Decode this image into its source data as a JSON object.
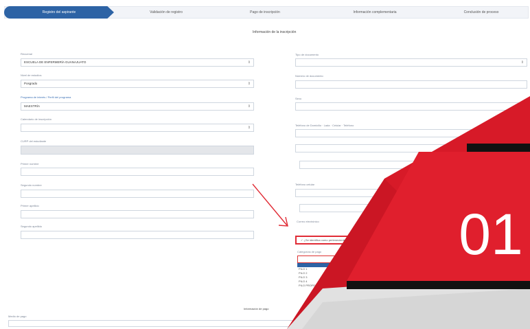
{
  "steps": [
    {
      "label": "Registro del aspirante",
      "active": true
    },
    {
      "label": "Validación de registro",
      "active": false
    },
    {
      "label": "Pago de inscripción",
      "active": false
    },
    {
      "label": "Información complementaria",
      "active": false
    },
    {
      "label": "Conclusión de proceso",
      "active": false
    }
  ],
  "section_title": "Información de la inscripción",
  "left_form": {
    "campus_label": "Recuenal",
    "campus_value": "ESCUELA DE ENFERMERÍA GUANAJUATO",
    "level_label": "Nivel de estudios",
    "level_value": "Posgrado",
    "program_label": "Programa de interés / Perfil del programa",
    "program_value": "MAESTRÍA",
    "calendar_label": "Calendario de inscripción",
    "name_label": "Primer nombre",
    "second_name_label": "Segundo nombre",
    "last1_label": "Primer apellido",
    "last2_label": "Segundo apellido",
    "curp_label": "CURP del estudiante"
  },
  "right_form": {
    "doc_type_label": "Tipo de documento",
    "doc_number_label": "Número de documento",
    "sex_label": "Sexo",
    "phone_label": "Teléfono de Domicilio · Lada · Celular · Teléfono",
    "mobile_label": "Teléfono celular",
    "email_label": "Correo electrónico"
  },
  "checkbox_label": "¿Se identifica como perteneciente a un grupo indígena?",
  "dropdown": {
    "label": "Categorías de pago",
    "options": [
      "",
      "PILO 1",
      "PILO 2",
      "PILO 3",
      "PILO 4",
      "PILO PROFESIONAL"
    ]
  },
  "payment_section": "Información de pago",
  "bottom_label": "Medio de pago",
  "badge": {
    "number": "01"
  },
  "colors": {
    "primary": "#2d63a5",
    "badge_red": "#e01f2d",
    "highlight": "#e02b35"
  }
}
